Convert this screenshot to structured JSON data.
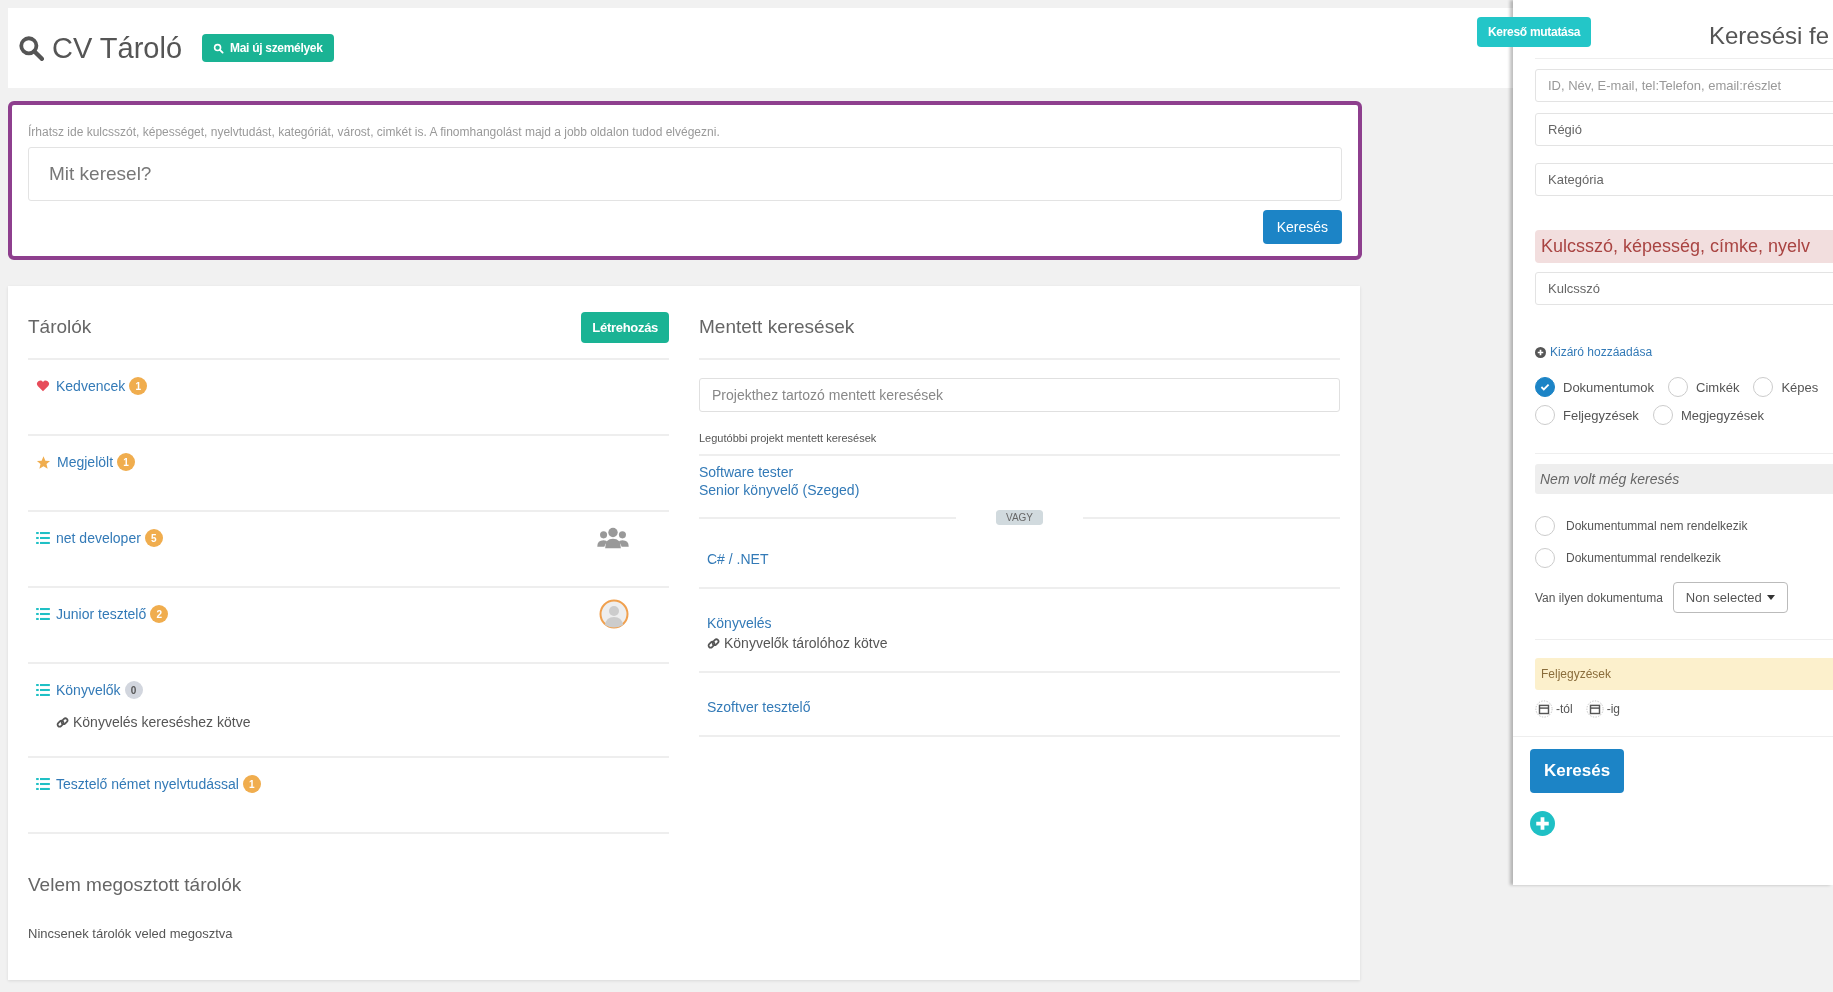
{
  "header": {
    "title": "CV Tároló",
    "button": "Mai új személyek"
  },
  "quick_search": {
    "hint": "Írhatsz ide kulcsszót, képességet, nyelvtudást, kategóriát, várost, cimkét is. A finomhangolást majd a jobb oldalon tudod elvégezni.",
    "placeholder": "Mit keresel?",
    "button": "Keresés"
  },
  "containers": {
    "title": "Tárolók",
    "create_button": "Létrehozás",
    "items": [
      {
        "kind": "favorite",
        "name": "Kedvencek",
        "count": "1",
        "color": "#f0ad4e"
      },
      {
        "kind": "marked",
        "name": "Megjelölt",
        "count": "1",
        "color": "#f0ad4e"
      },
      {
        "kind": "list",
        "name": "net developer",
        "count": "5",
        "color": "#f0ad4e",
        "access": {
          "kind": "group"
        }
      },
      {
        "kind": "list",
        "name": "Junior tesztelő",
        "count": "2",
        "color": "#f0ad4e",
        "access": {
          "kind": "person"
        }
      },
      {
        "kind": "list",
        "name": "Könyvelők",
        "count": "0",
        "color": "#d2d6de",
        "linked": "Könyvelés kereséshez kötve"
      },
      {
        "kind": "list",
        "name": "Tesztelő német nyelvtudással",
        "count": "1",
        "color": "#f0ad4e"
      }
    ]
  },
  "shared": {
    "title": "Velem megosztott tárolók",
    "empty_text": "Nincsenek tárolók veled megosztva"
  },
  "saved_searches": {
    "title": "Mentett keresések",
    "placeholder": "Projekthez tartozó mentett keresések",
    "recent_label": "Legutóbbi projekt mentett keresések",
    "recent": [
      "Software tester",
      "Senior könyvelő (Szeged)"
    ],
    "separator": "VAGY",
    "items": [
      {
        "name": "C# / .NET"
      },
      {
        "name": "Könyvelés",
        "linked": "Könyvelők tárolóhoz kötve"
      },
      {
        "name": "Szoftver tesztelő"
      }
    ]
  },
  "search_panel": {
    "toggle_button": "Kereső mutatása",
    "title": "Keresési fe",
    "fields": [
      {
        "placeholder": "ID, Név, E-mail, tel:Telefon, email:részlet"
      },
      {
        "placeholder": "Régió"
      },
      {
        "placeholder": "Kategória"
      }
    ],
    "keyword_heading": "Kulcsszó, képesség, címke, nyelv",
    "keyword_field": {
      "placeholder": "Kulcsszó"
    },
    "add_exclusion": "Kizáró hozzáadása",
    "sources": [
      {
        "label": "Dokumentumok",
        "checked": true
      },
      {
        "label": "Cimkék",
        "checked": false
      },
      {
        "label": "Képes",
        "checked": false
      },
      {
        "label": "Feljegyzések",
        "checked": false
      },
      {
        "label": "Megjegyzések",
        "checked": false
      }
    ],
    "history_note": "Nem volt még keresés",
    "document_options": [
      {
        "label": "Dokumentummal nem rendelkezik",
        "selected": false
      },
      {
        "label": "Dokumentummal rendelkezik",
        "selected": false
      }
    ],
    "document_filter": {
      "label": "Van ilyen dokumentuma",
      "value": "Non selected"
    },
    "notes_heading": "Feljegyzések",
    "date_from": "-tól",
    "date_to": "-ig",
    "search_button": "Keresés"
  }
}
